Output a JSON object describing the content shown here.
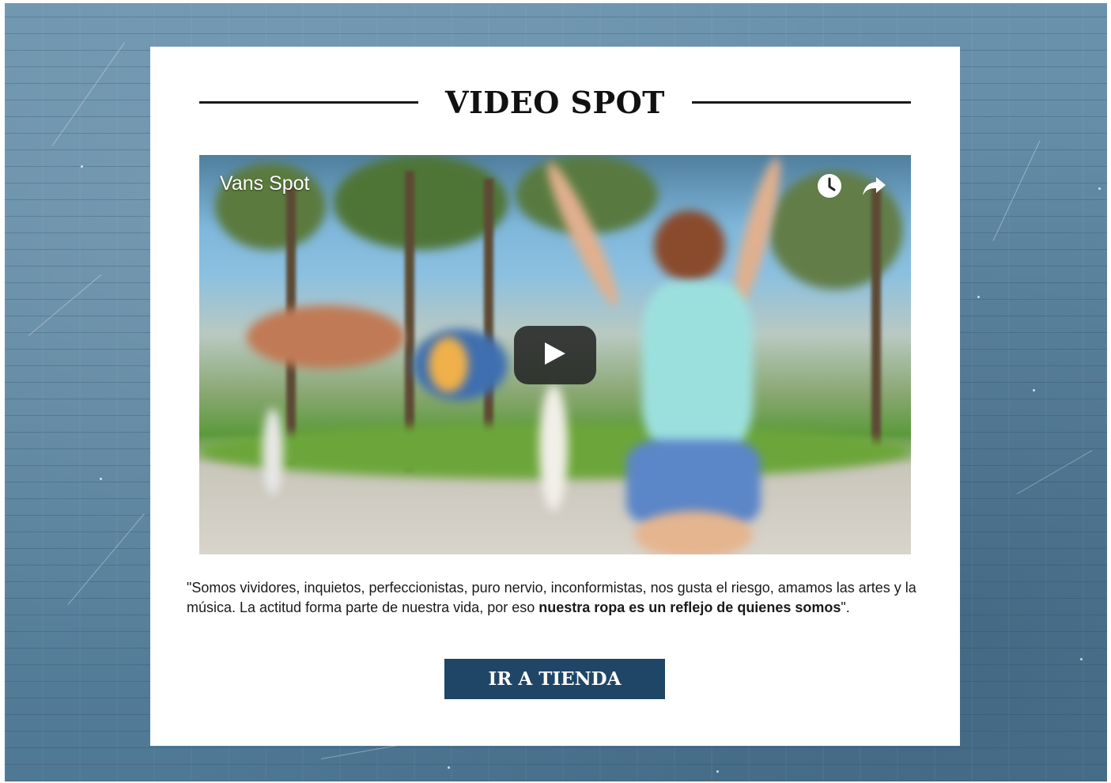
{
  "section": {
    "title": "VIDEO SPOT"
  },
  "video": {
    "title": "Vans Spot",
    "icons": [
      "clock-icon",
      "share-icon",
      "play-icon"
    ]
  },
  "quote": {
    "text_start": "\"Somos vividores, inquietos, perfeccionistas, puro nervio, inconformistas, nos gusta el riesgo, amamos las artes y la música. La actitud forma parte de nuestra vida, por eso ",
    "text_bold": "nuestra ropa es un reflejo de quienes somos",
    "text_end": "\"."
  },
  "cta": {
    "label": "IR A TIENDA",
    "color": "#1f4567"
  },
  "background": {
    "color": "#5b84a0"
  }
}
